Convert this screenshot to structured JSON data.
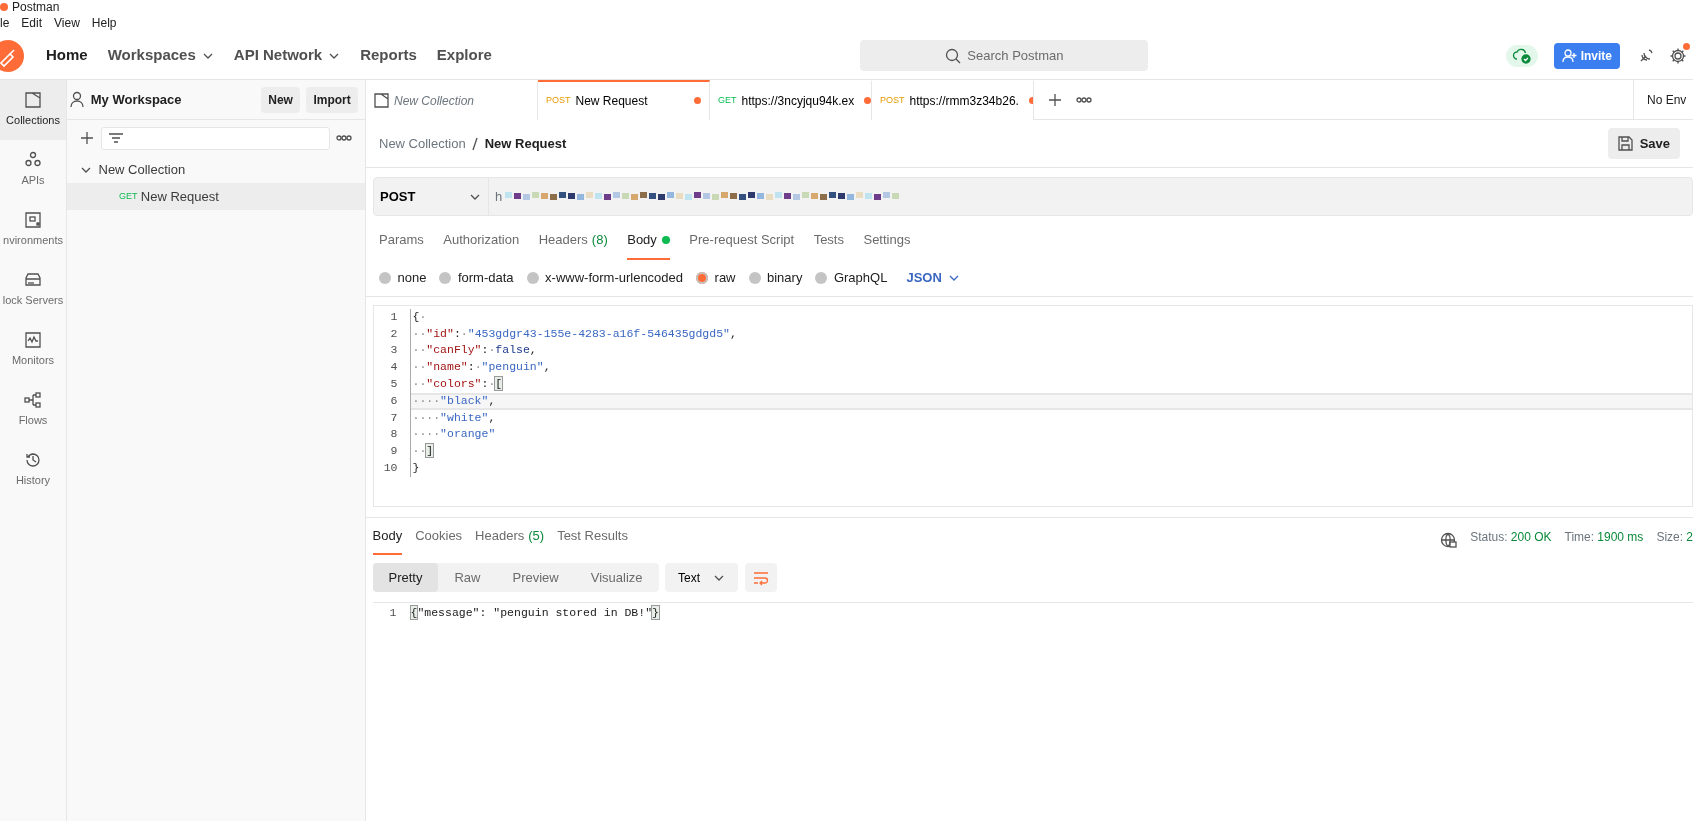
{
  "window": {
    "title": "Postman"
  },
  "menu": [
    "le",
    "Edit",
    "View",
    "Help"
  ],
  "nav": [
    {
      "label": "Home",
      "selected": true,
      "dropdown": false
    },
    {
      "label": "Workspaces",
      "selected": false,
      "dropdown": true
    },
    {
      "label": "API Network",
      "selected": false,
      "dropdown": true
    },
    {
      "label": "Reports",
      "selected": false,
      "dropdown": false
    },
    {
      "label": "Explore",
      "selected": false,
      "dropdown": false
    }
  ],
  "search": {
    "placeholder": "Search Postman"
  },
  "invite_button": "Invite",
  "settings_notification": true,
  "workspace": {
    "title": "My Workspace",
    "buttons": [
      "New",
      "Import"
    ]
  },
  "sidebar": {
    "items": [
      {
        "label": "Collections",
        "kind": "collections",
        "selected": true
      },
      {
        "label": "APIs",
        "kind": "apis",
        "selected": false
      },
      {
        "label": "nvironments",
        "kind": "environments",
        "selected": false
      },
      {
        "label": "lock Servers",
        "kind": "mock",
        "selected": false
      },
      {
        "label": "Monitors",
        "kind": "monitors",
        "selected": false
      },
      {
        "label": "Flows",
        "kind": "flows",
        "selected": false
      },
      {
        "label": "History",
        "kind": "history",
        "selected": false
      }
    ]
  },
  "tree": [
    {
      "label": "New Collection",
      "expanded": true,
      "children": [
        {
          "kind": "get",
          "method": "GET",
          "label": "New Request",
          "selected": true
        }
      ]
    }
  ],
  "tabs": [
    {
      "kind": "collection",
      "label": "New Collection",
      "selected": false,
      "unsaved": false
    },
    {
      "kind": "post",
      "method": "POST",
      "label": "New Request",
      "selected": true,
      "unsaved": true
    },
    {
      "kind": "get",
      "method": "GET",
      "label": "https://3ncyjqu94k.ex",
      "selected": false,
      "unsaved": true
    },
    {
      "kind": "post",
      "method": "POST",
      "label": "https://rmm3z34b26.",
      "selected": false,
      "unsaved": true
    }
  ],
  "environment": "No Env",
  "breadcrumb": [
    "New Collection",
    "New Request"
  ],
  "save_button": "Save",
  "request": {
    "method": "POST",
    "url_start": "h"
  },
  "request_tabs": [
    {
      "label": "Params",
      "selected": false
    },
    {
      "label": "Authorization",
      "selected": false
    },
    {
      "label": "Headers",
      "count": "(8)",
      "selected": false
    },
    {
      "label": "Body",
      "selected": true,
      "dot": true
    },
    {
      "label": "Pre-request Script",
      "selected": false
    },
    {
      "label": "Tests",
      "selected": false
    },
    {
      "label": "Settings",
      "selected": false
    }
  ],
  "body_types": [
    {
      "label": "none",
      "selected": false
    },
    {
      "label": "form-data",
      "selected": false
    },
    {
      "label": "x-www-form-urlencoded",
      "selected": false
    },
    {
      "label": "raw",
      "selected": true
    },
    {
      "label": "binary",
      "selected": false
    },
    {
      "label": "GraphQL",
      "selected": false
    }
  ],
  "body_format": "JSON",
  "editor": [
    {
      "number": "1",
      "active": false,
      "tokens": [
        {
          "kind": "punct",
          "text": "{"
        },
        {
          "kind": "indent",
          "text": "·"
        }
      ]
    },
    {
      "number": "2",
      "active": false,
      "tokens": [
        {
          "kind": "indent",
          "text": "··"
        },
        {
          "kind": "key",
          "text": "\"id\""
        },
        {
          "kind": "punct",
          "text": ":"
        },
        {
          "kind": "indent",
          "text": "·"
        },
        {
          "kind": "string",
          "text": "\"453gdgr43-155e-4283-a16f-546435gdgd5\""
        },
        {
          "kind": "punct",
          "text": ","
        }
      ]
    },
    {
      "number": "3",
      "active": false,
      "tokens": [
        {
          "kind": "indent",
          "text": "··"
        },
        {
          "kind": "key",
          "text": "\"canFly\""
        },
        {
          "kind": "punct",
          "text": ":"
        },
        {
          "kind": "indent",
          "text": "·"
        },
        {
          "kind": "bool",
          "text": "false"
        },
        {
          "kind": "punct",
          "text": ","
        }
      ]
    },
    {
      "number": "4",
      "active": false,
      "tokens": [
        {
          "kind": "indent",
          "text": "··"
        },
        {
          "kind": "key",
          "text": "\"name\""
        },
        {
          "kind": "punct",
          "text": ":"
        },
        {
          "kind": "indent",
          "text": "·"
        },
        {
          "kind": "string",
          "text": "\"penguin\""
        },
        {
          "kind": "punct",
          "text": ","
        }
      ]
    },
    {
      "number": "5",
      "active": false,
      "tokens": [
        {
          "kind": "indent",
          "text": "··"
        },
        {
          "kind": "key",
          "text": "\"colors\""
        },
        {
          "kind": "punct",
          "text": ":"
        },
        {
          "kind": "indent",
          "text": "·"
        },
        {
          "kind": "match",
          "text": "["
        }
      ]
    },
    {
      "number": "6",
      "active": true,
      "tokens": [
        {
          "kind": "indent",
          "text": "····"
        },
        {
          "kind": "string",
          "text": "\"black\""
        },
        {
          "kind": "punct",
          "text": ","
        }
      ]
    },
    {
      "number": "7",
      "active": false,
      "tokens": [
        {
          "kind": "indent",
          "text": "····"
        },
        {
          "kind": "string",
          "text": "\"white\""
        },
        {
          "kind": "punct",
          "text": ","
        }
      ]
    },
    {
      "number": "8",
      "active": false,
      "tokens": [
        {
          "kind": "indent",
          "text": "····"
        },
        {
          "kind": "string",
          "text": "\"orange\""
        }
      ]
    },
    {
      "number": "9",
      "active": false,
      "tokens": [
        {
          "kind": "indent",
          "text": "··"
        },
        {
          "kind": "match",
          "text": "]"
        }
      ]
    },
    {
      "number": "10",
      "active": false,
      "tokens": [
        {
          "kind": "punct",
          "text": "}"
        }
      ]
    }
  ],
  "response_tabs": [
    {
      "label": "Body",
      "selected": true
    },
    {
      "label": "Cookies",
      "selected": false
    },
    {
      "label": "Headers",
      "count": "(5)",
      "selected": false
    },
    {
      "label": "Test Results",
      "selected": false
    }
  ],
  "response_status": [
    {
      "label": "Status:",
      "value": "200 OK"
    },
    {
      "label": "Time:",
      "value": "1900 ms"
    },
    {
      "label": "Size:",
      "value": "2"
    }
  ],
  "view_modes": [
    {
      "label": "Pretty",
      "selected": true
    },
    {
      "label": "Raw",
      "selected": false
    },
    {
      "label": "Preview",
      "selected": false
    },
    {
      "label": "Visualize",
      "selected": false
    }
  ],
  "response_format": "Text",
  "response_body": [
    {
      "number": "1",
      "tokens": [
        {
          "kind": "match",
          "text": "{"
        },
        {
          "kind": "plain",
          "text": "\"message\": \"penguin stored in DB!\""
        },
        {
          "kind": "match",
          "text": "}"
        }
      ]
    }
  ]
}
